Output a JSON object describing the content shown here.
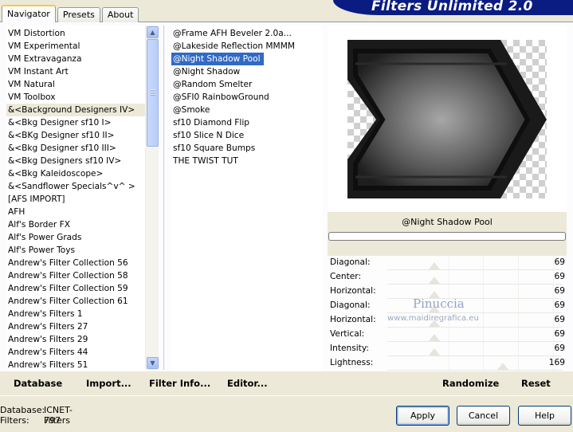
{
  "tabs": [
    "Navigator",
    "Presets",
    "About"
  ],
  "banner_title": "Filters Unlimited 2.0",
  "categories": [
    "VM Distortion",
    "VM Experimental",
    "VM Extravaganza",
    "VM Instant Art",
    "VM Natural",
    "VM Toolbox",
    "&<Background Designers IV>",
    "&<Bkg Designer sf10 I>",
    "&<BKg Designer sf10 II>",
    "&<Bkg Designer sf10 III>",
    "&<Bkg Designers sf10 IV>",
    "&<Bkg Kaleidoscope>",
    "&<Sandflower Specials^v^ >",
    "[AFS IMPORT]",
    "AFH",
    "Alf's Border FX",
    "Alf's Power Grads",
    "Alf's Power Toys",
    "Andrew's Filter Collection 56",
    "Andrew's Filter Collection 58",
    "Andrew's Filter Collection 59",
    "Andrew's Filter Collection 61",
    "Andrew's Filters 1",
    "Andrew's Filters 27",
    "Andrew's Filters 29",
    "Andrew's Filters 44",
    "Andrew's Filters 51"
  ],
  "selected_category_index": 6,
  "filters": [
    "@Frame AFH Beveler 2.0a...",
    "@Lakeside Reflection MMMM",
    "@Night Shadow Pool",
    "@Night Shadow",
    "@Random Smelter",
    "@SFI0 RainbowGround",
    "@Smoke",
    "sf10 Diamond Flip",
    "sf10 Slice N Dice",
    "sf10 Square Bumps",
    "THE TWIST TUT"
  ],
  "selected_filter_index": 2,
  "preview_filter_name": "@Night Shadow Pool",
  "sliders": [
    {
      "label": "Diagonal:",
      "value": 69
    },
    {
      "label": "Center:",
      "value": 69
    },
    {
      "label": "Horizontal:",
      "value": 69
    },
    {
      "label": "Diagonal:",
      "value": 69
    },
    {
      "label": "Horizontal:",
      "value": 69
    },
    {
      "label": "Vertical:",
      "value": 69
    },
    {
      "label": "Intensity:",
      "value": 69
    },
    {
      "label": "Lightness:",
      "value": 169
    }
  ],
  "slider_max": 255,
  "watermark": {
    "name": "Pinuccia",
    "site": "www.maidiregrafica.eu"
  },
  "bottom_left": {
    "database": "Database",
    "import": "Import...",
    "filter_info": "Filter Info...",
    "editor": "Editor..."
  },
  "bottom_right": {
    "randomize": "Randomize",
    "reset": "Reset"
  },
  "info": {
    "database_label": "Database:",
    "database_value": "ICNET-Filters",
    "filters_label": "Filters:",
    "filters_value": "797"
  },
  "buttons": {
    "apply": "Apply",
    "cancel": "Cancel",
    "help": "Help"
  },
  "colors": {
    "selection": "#316ac5",
    "banner": "#0a1c82",
    "dialog_bg": "#ece9d8"
  }
}
